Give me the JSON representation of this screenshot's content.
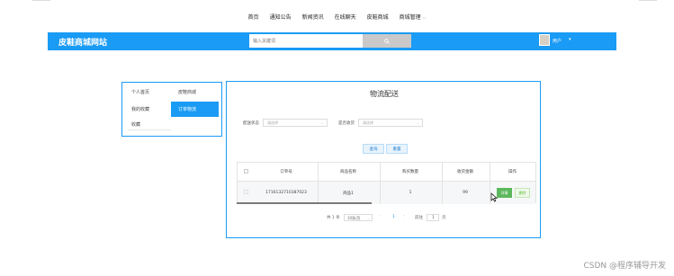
{
  "nav": {
    "items": [
      "首页",
      "通知公告",
      "新闻资讯",
      "在线聊天",
      "皮鞋商城",
      "商城管理"
    ]
  },
  "header": {
    "brand": "皮鞋商城网站",
    "search_placeholder": "输入关键词",
    "username": "用户",
    "accent_color": "#1a9bf5"
  },
  "sidebar": {
    "items": [
      {
        "label": "个人首页",
        "active": false
      },
      {
        "label": "皮鞋商城",
        "active": false
      },
      {
        "label": "我的收藏",
        "active": false
      },
      {
        "label": "订单物流",
        "active": true
      },
      {
        "label": "收藏",
        "active": false
      }
    ]
  },
  "main": {
    "title": "物流配送",
    "filters": [
      {
        "label": "配送状态",
        "placeholder": "请选择"
      },
      {
        "label": "是否收货",
        "placeholder": "请选择"
      }
    ],
    "buttons": {
      "query": "查询",
      "reset": "重置"
    },
    "table": {
      "columns": [
        "订单号",
        "商品名称",
        "购买数量",
        "收货金额",
        "操作"
      ],
      "rows": [
        {
          "order_no": "1716132710387023",
          "product": "商品1",
          "qty": "1",
          "amount": "99",
          "actions": [
            "详情",
            "删除"
          ]
        }
      ]
    },
    "pagination": {
      "total": "共 1 条",
      "page_size": "10条/页",
      "prev": "‹",
      "current": "1",
      "next": "›",
      "goto_label": "前往",
      "goto_value": "1",
      "page_unit": "页"
    }
  },
  "watermark": "CSDN @程序辅导开发"
}
